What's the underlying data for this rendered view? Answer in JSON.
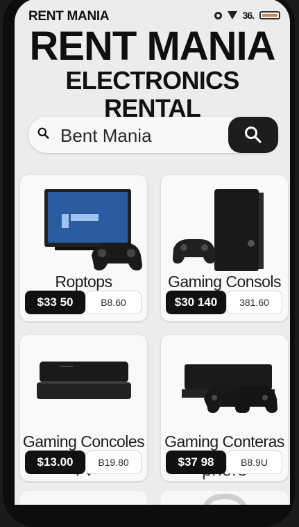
{
  "status": {
    "brand": "RENT MANIA",
    "signal": "36."
  },
  "header": {
    "title": "RENT MANIA",
    "subtitle": "ELECTRONICS RENTAL"
  },
  "search": {
    "placeholder": "Bent Mania"
  },
  "products": [
    {
      "title": "Roptops",
      "subtitle": "",
      "price_primary": "$33 50",
      "price_secondary": "B8.60"
    },
    {
      "title": "Gaming Consols",
      "subtitle": "",
      "price_primary": "$30 140",
      "price_secondary": "381.60"
    },
    {
      "title": "Gaming Concoles",
      "subtitle": "TV",
      "price_primary": "$13.00",
      "price_secondary": "B19.80"
    },
    {
      "title": "Gaming Conteras",
      "subtitle": "phors",
      "price_primary": "$37 98",
      "price_secondary": "B8.9U"
    }
  ],
  "colors": {
    "accent": "#111111",
    "screen_bg": "#ececed",
    "tv_screen": "#2b5c9f"
  }
}
